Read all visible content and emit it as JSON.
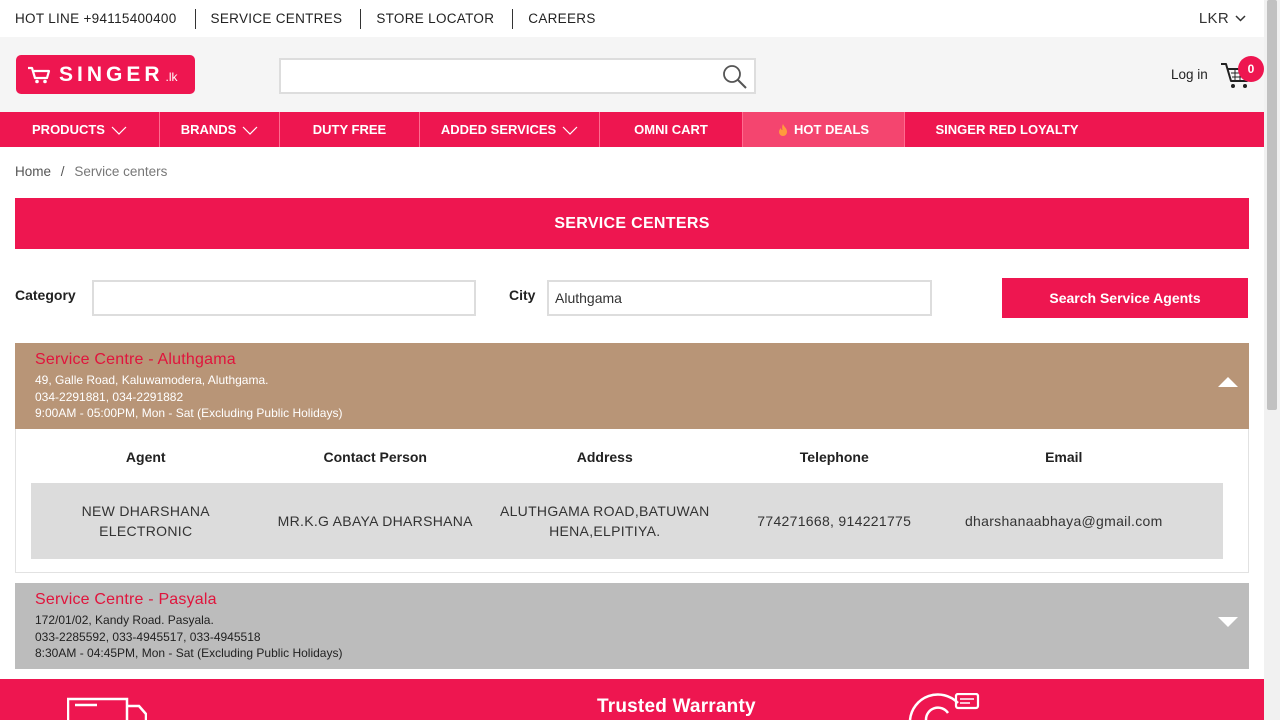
{
  "topbar": {
    "hotline": "HOT LINE +94115400400",
    "service_centres": "SERVICE CENTRES",
    "store_locator": "STORE LOCATOR",
    "careers": "CAREERS",
    "currency": "LKR"
  },
  "header": {
    "logo_text": "SINGER",
    "logo_suffix": ".lk",
    "search_placeholder": "",
    "login": "Log in",
    "cart_count": "0"
  },
  "nav": [
    {
      "label": "PRODUCTS"
    },
    {
      "label": "BRANDS"
    },
    {
      "label": "DUTY FREE"
    },
    {
      "label": "ADDED SERVICES"
    },
    {
      "label": "OMNI CART"
    },
    {
      "label": "HOT DEALS"
    },
    {
      "label": "SINGER RED LOYALTY"
    }
  ],
  "breadcrumb": {
    "home": "Home",
    "sep": "/",
    "current": "Service centers"
  },
  "banner": "SERVICE CENTERS",
  "filters": {
    "category_label": "Category",
    "category_value": "",
    "city_label": "City",
    "city_value": "Aluthgama",
    "search_button": "Search Service Agents"
  },
  "centres": [
    {
      "name": "Service Centre - Aluthgama",
      "address": "49, Galle Road, Kaluwamodera, Aluthgama.",
      "phones": "034-2291881, 034-2291882",
      "hours": "9:00AM - 05:00PM, Mon - Sat (Excluding Public Holidays)"
    },
    {
      "name": "Service Centre - Pasyala",
      "address": "172/01/02, Kandy Road. Pasyala.",
      "phones": "033-2285592, 033-4945517, 033-4945518",
      "hours": "8:30AM - 04:45PM, Mon - Sat (Excluding Public Holidays)"
    }
  ],
  "agents_table": {
    "headers": [
      "Agent",
      "Contact Person",
      "Address",
      "Telephone",
      "Email"
    ],
    "rows": [
      [
        "NEW DHARSHANA ELECTRONIC",
        "MR.K.G ABAYA DHARSHANA",
        "ALUTHGAMA ROAD,BATUWANHENA,ELPITIYA.",
        "774271668, 914221775",
        "dharshanaabhaya@gmail.com"
      ]
    ]
  },
  "footer": {
    "trusted_warranty": "Trusted Warranty"
  },
  "colors": {
    "brand": "#ee1650",
    "open_panel": "#b89577",
    "closed_panel": "#bcbcbc"
  }
}
